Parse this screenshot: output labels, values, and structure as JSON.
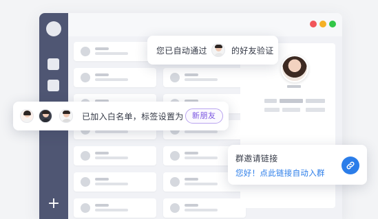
{
  "window": {
    "controls": [
      {
        "name": "close-dot",
        "color": "#f2555a"
      },
      {
        "name": "minimize-dot",
        "color": "#f5b026"
      },
      {
        "name": "maximize-dot",
        "color": "#33c748"
      }
    ]
  },
  "sidebar": {
    "add_icon": "plus-icon",
    "add_glyph": "+"
  },
  "toasts": {
    "verify": {
      "text_before": "您已自动通过",
      "text_after": "的好友验证",
      "avatar_icon": "user-avatar-icon"
    },
    "whitelist": {
      "text": "已加入白名单，标签设置为",
      "tag": "新朋友",
      "avatar_icons": [
        "user-avatar-icon",
        "user-avatar-icon",
        "user-avatar-icon"
      ]
    },
    "invite": {
      "title": "群邀请链接",
      "message": "您好！点此链接自动入群",
      "button_icon": "link-icon"
    }
  },
  "colors": {
    "sidebar": "#4f5673",
    "accent_blue": "#2b7de9",
    "tag_purple": "#7a55e0"
  }
}
